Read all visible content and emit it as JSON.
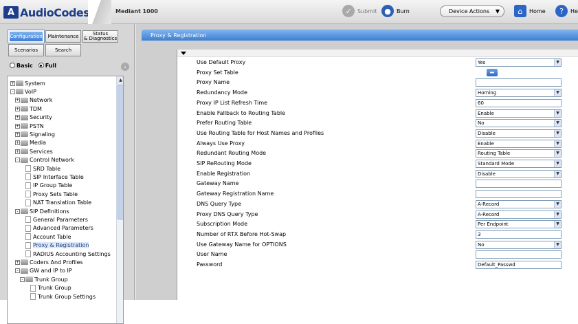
{
  "header": {
    "logo_text": "AudioCodes",
    "product": "Mediant 1000",
    "submit_label": "Submit",
    "burn_label": "Burn",
    "device_actions_label": "Device Actions",
    "home_label": "Home",
    "help_label": "He"
  },
  "left": {
    "tabs": {
      "configuration": "Configuration",
      "maintenance": "Maintenance",
      "status_line1": "Status",
      "status_line2": "& Diagnostics",
      "scenarios": "Scenarios",
      "search": "Search"
    },
    "mode_basic": "Basic",
    "mode_full": "Full",
    "tree": [
      {
        "label": "System",
        "level": 0,
        "type": "folder",
        "exp": "+"
      },
      {
        "label": "VoIP",
        "level": 0,
        "type": "folder",
        "exp": "-"
      },
      {
        "label": "Network",
        "level": 1,
        "type": "folder",
        "exp": "+"
      },
      {
        "label": "TDM",
        "level": 1,
        "type": "folder",
        "exp": "+"
      },
      {
        "label": "Security",
        "level": 1,
        "type": "folder",
        "exp": "+"
      },
      {
        "label": "PSTN",
        "level": 1,
        "type": "folder",
        "exp": "+"
      },
      {
        "label": "Signaling",
        "level": 1,
        "type": "folder",
        "exp": "+"
      },
      {
        "label": "Media",
        "level": 1,
        "type": "folder",
        "exp": "+"
      },
      {
        "label": "Services",
        "level": 1,
        "type": "folder",
        "exp": "+"
      },
      {
        "label": "Control Network",
        "level": 1,
        "type": "folder",
        "exp": "-"
      },
      {
        "label": "SRD Table",
        "level": 2,
        "type": "doc"
      },
      {
        "label": "SIP Interface Table",
        "level": 2,
        "type": "doc"
      },
      {
        "label": "IP Group Table",
        "level": 2,
        "type": "doc"
      },
      {
        "label": "Proxy Sets Table",
        "level": 2,
        "type": "doc"
      },
      {
        "label": "NAT Translation Table",
        "level": 2,
        "type": "doc"
      },
      {
        "label": "SIP Definitions",
        "level": 1,
        "type": "folder",
        "exp": "-"
      },
      {
        "label": "General Parameters",
        "level": 2,
        "type": "doc"
      },
      {
        "label": "Advanced Parameters",
        "level": 2,
        "type": "doc"
      },
      {
        "label": "Account Table",
        "level": 2,
        "type": "doc"
      },
      {
        "label": "Proxy & Registration",
        "level": 2,
        "type": "doc",
        "selected": true
      },
      {
        "label": "RADIUS Accounting Settings",
        "level": 2,
        "type": "doc"
      },
      {
        "label": "Coders And Profiles",
        "level": 1,
        "type": "folder",
        "exp": "+"
      },
      {
        "label": "GW and IP to IP",
        "level": 1,
        "type": "folder",
        "exp": "-"
      },
      {
        "label": "Trunk Group",
        "level": 2,
        "type": "folder",
        "exp": "-"
      },
      {
        "label": "Trunk Group",
        "level": 3,
        "type": "doc"
      },
      {
        "label": "Trunk Group Settings",
        "level": 3,
        "type": "doc"
      }
    ]
  },
  "page": {
    "title": "Proxy & Registration",
    "rows": [
      {
        "label": "Use Default Proxy",
        "kind": "select",
        "value": "Yes"
      },
      {
        "label": "Proxy Set Table",
        "kind": "button",
        "value": "➡"
      },
      {
        "label": "Proxy Name",
        "kind": "input",
        "value": ""
      },
      {
        "label": "Redundancy Mode",
        "kind": "select",
        "value": "Homing"
      },
      {
        "label": "Proxy IP List Refresh Time",
        "kind": "input",
        "value": "60"
      },
      {
        "label": "Enable Fallback to Routing Table",
        "kind": "select",
        "value": "Enable"
      },
      {
        "label": "Prefer Routing Table",
        "kind": "select",
        "value": "No"
      },
      {
        "label": "Use Routing Table for Host Names and Profiles",
        "kind": "select",
        "value": "Disable"
      },
      {
        "label": "Always Use Proxy",
        "kind": "select",
        "value": "Enable"
      },
      {
        "label": "Redundant Routing Mode",
        "kind": "select",
        "value": "Routing Table"
      },
      {
        "label": "SIP ReRouting Mode",
        "kind": "select",
        "value": "Standard Mode"
      },
      {
        "label": "Enable Registration",
        "kind": "select",
        "value": "Disable"
      },
      {
        "label": "Gateway Name",
        "kind": "input",
        "value": ""
      },
      {
        "label": "Gateway Registration Name",
        "kind": "input",
        "value": ""
      },
      {
        "label": "DNS Query Type",
        "kind": "select",
        "value": "A-Record"
      },
      {
        "label": "Proxy DNS Query Type",
        "kind": "select",
        "value": "A-Record"
      },
      {
        "label": "Subscription Mode",
        "kind": "select",
        "value": "Per Endpoint"
      },
      {
        "label": "Number of RTX Before Hot-Swap",
        "kind": "input",
        "value": "3"
      },
      {
        "label": "Use Gateway Name for OPTIONS",
        "kind": "select",
        "value": "No"
      },
      {
        "label": "User Name",
        "kind": "input",
        "value": ""
      },
      {
        "label": "Password",
        "kind": "input",
        "value": "Default_Passwd"
      }
    ]
  },
  "colors": {
    "brand": "#1e3e8c",
    "title_bar": "#3f7fd2",
    "panel_bg": "#cfcfcf"
  }
}
